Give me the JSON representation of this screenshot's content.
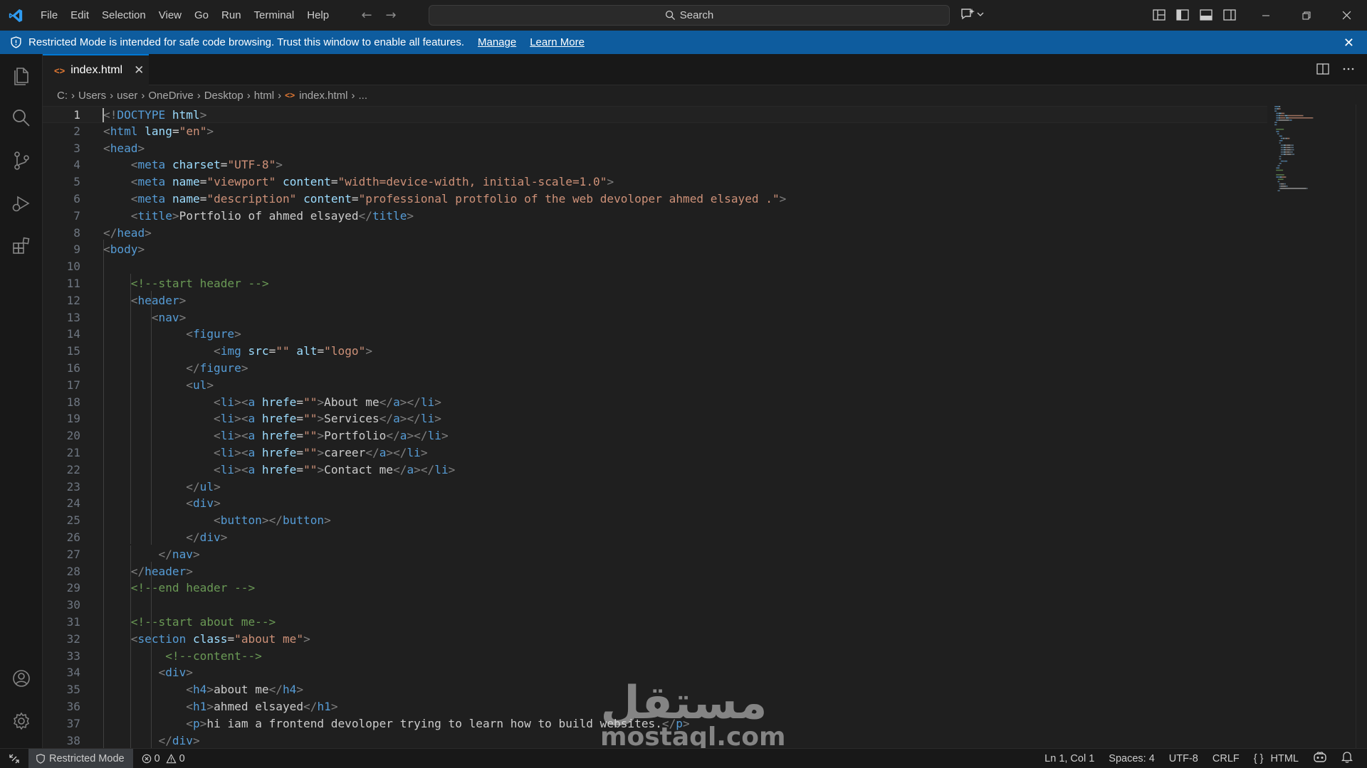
{
  "titlebar": {
    "menu": [
      "File",
      "Edit",
      "Selection",
      "View",
      "Go",
      "Run",
      "Terminal",
      "Help"
    ],
    "search_label": "Search",
    "back_icon": "arrow-left-icon",
    "forward_icon": "arrow-right-icon"
  },
  "banner": {
    "text": "Restricted Mode is intended for safe code browsing. Trust this window to enable all features.",
    "manage_label": "Manage",
    "learn_more_label": "Learn More",
    "color": "#0e5c9e"
  },
  "tabs": [
    {
      "label": "index.html",
      "active": true,
      "icon_text": "<>"
    }
  ],
  "breadcrumb": {
    "items": [
      "C:",
      "Users",
      "user",
      "OneDrive",
      "Desktop",
      "html",
      "index.html",
      "..."
    ],
    "file_icon_text": "<>"
  },
  "editor": {
    "lines": [
      {
        "n": "1",
        "tokens": [
          [
            "t-tag",
            "<!"
          ],
          [
            "t-kw",
            "DOCTYPE"
          ],
          [
            "t-txt",
            " "
          ],
          [
            "t-attr",
            "html"
          ],
          [
            "t-tag",
            ">"
          ]
        ]
      },
      {
        "n": "2",
        "tokens": [
          [
            "t-tag",
            "<"
          ],
          [
            "t-name",
            "html"
          ],
          [
            "t-txt",
            " "
          ],
          [
            "t-attr",
            "lang"
          ],
          [
            "t-txt",
            "="
          ],
          [
            "t-str",
            "\"en\""
          ],
          [
            "t-tag",
            ">"
          ]
        ]
      },
      {
        "n": "3",
        "tokens": [
          [
            "t-tag",
            "<"
          ],
          [
            "t-name",
            "head"
          ],
          [
            "t-tag",
            ">"
          ]
        ]
      },
      {
        "n": "4",
        "tokens": [
          [
            "t-txt",
            "    "
          ],
          [
            "t-tag",
            "<"
          ],
          [
            "t-name",
            "meta"
          ],
          [
            "t-txt",
            " "
          ],
          [
            "t-attr",
            "charset"
          ],
          [
            "t-txt",
            "="
          ],
          [
            "t-str",
            "\"UTF-8\""
          ],
          [
            "t-tag",
            ">"
          ]
        ]
      },
      {
        "n": "5",
        "tokens": [
          [
            "t-txt",
            "    "
          ],
          [
            "t-tag",
            "<"
          ],
          [
            "t-name",
            "meta"
          ],
          [
            "t-txt",
            " "
          ],
          [
            "t-attr",
            "name"
          ],
          [
            "t-txt",
            "="
          ],
          [
            "t-str",
            "\"viewport\""
          ],
          [
            "t-txt",
            " "
          ],
          [
            "t-attr",
            "content"
          ],
          [
            "t-txt",
            "="
          ],
          [
            "t-str",
            "\"width=device-width, initial-scale=1.0\""
          ],
          [
            "t-tag",
            ">"
          ]
        ]
      },
      {
        "n": "6",
        "tokens": [
          [
            "t-txt",
            "    "
          ],
          [
            "t-tag",
            "<"
          ],
          [
            "t-name",
            "meta"
          ],
          [
            "t-txt",
            " "
          ],
          [
            "t-attr",
            "name"
          ],
          [
            "t-txt",
            "="
          ],
          [
            "t-str",
            "\"description\""
          ],
          [
            "t-txt",
            " "
          ],
          [
            "t-attr",
            "content"
          ],
          [
            "t-txt",
            "="
          ],
          [
            "t-str",
            "\"professional protfolio of the web devoloper ahmed elsayed .\""
          ],
          [
            "t-tag",
            ">"
          ]
        ]
      },
      {
        "n": "7",
        "tokens": [
          [
            "t-txt",
            "    "
          ],
          [
            "t-tag",
            "<"
          ],
          [
            "t-name",
            "title"
          ],
          [
            "t-tag",
            ">"
          ],
          [
            "t-txt",
            "Portfolio of ahmed elsayed"
          ],
          [
            "t-tag",
            "</"
          ],
          [
            "t-name",
            "title"
          ],
          [
            "t-tag",
            ">"
          ]
        ]
      },
      {
        "n": "8",
        "tokens": [
          [
            "t-tag",
            "</"
          ],
          [
            "t-name",
            "head"
          ],
          [
            "t-tag",
            ">"
          ]
        ]
      },
      {
        "n": "9",
        "tokens": [
          [
            "t-tag",
            "<"
          ],
          [
            "t-name",
            "body"
          ],
          [
            "t-tag",
            ">"
          ]
        ]
      },
      {
        "n": "10",
        "tokens": []
      },
      {
        "n": "11",
        "tokens": [
          [
            "t-txt",
            "    "
          ],
          [
            "t-cmt",
            "<!--start header -->"
          ]
        ]
      },
      {
        "n": "12",
        "tokens": [
          [
            "t-txt",
            "    "
          ],
          [
            "t-tag",
            "<"
          ],
          [
            "t-name",
            "header"
          ],
          [
            "t-tag",
            ">"
          ]
        ]
      },
      {
        "n": "13",
        "tokens": [
          [
            "t-txt",
            "       "
          ],
          [
            "t-tag",
            "<"
          ],
          [
            "t-name",
            "nav"
          ],
          [
            "t-tag",
            ">"
          ]
        ]
      },
      {
        "n": "14",
        "tokens": [
          [
            "t-txt",
            "            "
          ],
          [
            "t-tag",
            "<"
          ],
          [
            "t-name",
            "figure"
          ],
          [
            "t-tag",
            ">"
          ]
        ]
      },
      {
        "n": "15",
        "tokens": [
          [
            "t-txt",
            "                "
          ],
          [
            "t-tag",
            "<"
          ],
          [
            "t-name",
            "img"
          ],
          [
            "t-txt",
            " "
          ],
          [
            "t-attr",
            "src"
          ],
          [
            "t-txt",
            "="
          ],
          [
            "t-str",
            "\"\""
          ],
          [
            "t-txt",
            " "
          ],
          [
            "t-attr",
            "alt"
          ],
          [
            "t-txt",
            "="
          ],
          [
            "t-str",
            "\"logo\""
          ],
          [
            "t-tag",
            ">"
          ]
        ]
      },
      {
        "n": "16",
        "tokens": [
          [
            "t-txt",
            "            "
          ],
          [
            "t-tag",
            "</"
          ],
          [
            "t-name",
            "figure"
          ],
          [
            "t-tag",
            ">"
          ]
        ]
      },
      {
        "n": "17",
        "tokens": [
          [
            "t-txt",
            "            "
          ],
          [
            "t-tag",
            "<"
          ],
          [
            "t-name",
            "ul"
          ],
          [
            "t-tag",
            ">"
          ]
        ]
      },
      {
        "n": "18",
        "tokens": [
          [
            "t-txt",
            "                "
          ],
          [
            "t-tag",
            "<"
          ],
          [
            "t-name",
            "li"
          ],
          [
            "t-tag",
            "><"
          ],
          [
            "t-name",
            "a"
          ],
          [
            "t-txt",
            " "
          ],
          [
            "t-attr",
            "hrefe"
          ],
          [
            "t-txt",
            "="
          ],
          [
            "t-str",
            "\"\""
          ],
          [
            "t-tag",
            ">"
          ],
          [
            "t-txt",
            "About me"
          ],
          [
            "t-tag",
            "</"
          ],
          [
            "t-name",
            "a"
          ],
          [
            "t-tag",
            "></"
          ],
          [
            "t-name",
            "li"
          ],
          [
            "t-tag",
            ">"
          ]
        ]
      },
      {
        "n": "19",
        "tokens": [
          [
            "t-txt",
            "                "
          ],
          [
            "t-tag",
            "<"
          ],
          [
            "t-name",
            "li"
          ],
          [
            "t-tag",
            "><"
          ],
          [
            "t-name",
            "a"
          ],
          [
            "t-txt",
            " "
          ],
          [
            "t-attr",
            "hrefe"
          ],
          [
            "t-txt",
            "="
          ],
          [
            "t-str",
            "\"\""
          ],
          [
            "t-tag",
            ">"
          ],
          [
            "t-txt",
            "Services"
          ],
          [
            "t-tag",
            "</"
          ],
          [
            "t-name",
            "a"
          ],
          [
            "t-tag",
            "></"
          ],
          [
            "t-name",
            "li"
          ],
          [
            "t-tag",
            ">"
          ]
        ]
      },
      {
        "n": "20",
        "tokens": [
          [
            "t-txt",
            "                "
          ],
          [
            "t-tag",
            "<"
          ],
          [
            "t-name",
            "li"
          ],
          [
            "t-tag",
            "><"
          ],
          [
            "t-name",
            "a"
          ],
          [
            "t-txt",
            " "
          ],
          [
            "t-attr",
            "hrefe"
          ],
          [
            "t-txt",
            "="
          ],
          [
            "t-str",
            "\"\""
          ],
          [
            "t-tag",
            ">"
          ],
          [
            "t-txt",
            "Portfolio"
          ],
          [
            "t-tag",
            "</"
          ],
          [
            "t-name",
            "a"
          ],
          [
            "t-tag",
            "></"
          ],
          [
            "t-name",
            "li"
          ],
          [
            "t-tag",
            ">"
          ]
        ]
      },
      {
        "n": "21",
        "tokens": [
          [
            "t-txt",
            "                "
          ],
          [
            "t-tag",
            "<"
          ],
          [
            "t-name",
            "li"
          ],
          [
            "t-tag",
            "><"
          ],
          [
            "t-name",
            "a"
          ],
          [
            "t-txt",
            " "
          ],
          [
            "t-attr",
            "hrefe"
          ],
          [
            "t-txt",
            "="
          ],
          [
            "t-str",
            "\"\""
          ],
          [
            "t-tag",
            ">"
          ],
          [
            "t-txt",
            "career"
          ],
          [
            "t-tag",
            "</"
          ],
          [
            "t-name",
            "a"
          ],
          [
            "t-tag",
            "></"
          ],
          [
            "t-name",
            "li"
          ],
          [
            "t-tag",
            ">"
          ]
        ]
      },
      {
        "n": "22",
        "tokens": [
          [
            "t-txt",
            "                "
          ],
          [
            "t-tag",
            "<"
          ],
          [
            "t-name",
            "li"
          ],
          [
            "t-tag",
            "><"
          ],
          [
            "t-name",
            "a"
          ],
          [
            "t-txt",
            " "
          ],
          [
            "t-attr",
            "hrefe"
          ],
          [
            "t-txt",
            "="
          ],
          [
            "t-str",
            "\"\""
          ],
          [
            "t-tag",
            ">"
          ],
          [
            "t-txt",
            "Contact me"
          ],
          [
            "t-tag",
            "</"
          ],
          [
            "t-name",
            "a"
          ],
          [
            "t-tag",
            "></"
          ],
          [
            "t-name",
            "li"
          ],
          [
            "t-tag",
            ">"
          ]
        ]
      },
      {
        "n": "23",
        "tokens": [
          [
            "t-txt",
            "            "
          ],
          [
            "t-tag",
            "</"
          ],
          [
            "t-name",
            "ul"
          ],
          [
            "t-tag",
            ">"
          ]
        ]
      },
      {
        "n": "24",
        "tokens": [
          [
            "t-txt",
            "            "
          ],
          [
            "t-tag",
            "<"
          ],
          [
            "t-name",
            "div"
          ],
          [
            "t-tag",
            ">"
          ]
        ]
      },
      {
        "n": "25",
        "tokens": [
          [
            "t-txt",
            "                "
          ],
          [
            "t-tag",
            "<"
          ],
          [
            "t-name",
            "button"
          ],
          [
            "t-tag",
            "></"
          ],
          [
            "t-name",
            "button"
          ],
          [
            "t-tag",
            ">"
          ]
        ]
      },
      {
        "n": "26",
        "tokens": [
          [
            "t-txt",
            "            "
          ],
          [
            "t-tag",
            "</"
          ],
          [
            "t-name",
            "div"
          ],
          [
            "t-tag",
            ">"
          ]
        ]
      },
      {
        "n": "27",
        "tokens": [
          [
            "t-txt",
            "        "
          ],
          [
            "t-tag",
            "</"
          ],
          [
            "t-name",
            "nav"
          ],
          [
            "t-tag",
            ">"
          ]
        ]
      },
      {
        "n": "28",
        "tokens": [
          [
            "t-txt",
            "    "
          ],
          [
            "t-tag",
            "</"
          ],
          [
            "t-name",
            "header"
          ],
          [
            "t-tag",
            ">"
          ]
        ]
      },
      {
        "n": "29",
        "tokens": [
          [
            "t-txt",
            "    "
          ],
          [
            "t-cmt",
            "<!--end header -->"
          ]
        ]
      },
      {
        "n": "30",
        "tokens": []
      },
      {
        "n": "31",
        "tokens": [
          [
            "t-txt",
            "    "
          ],
          [
            "t-cmt",
            "<!--start about me-->"
          ]
        ]
      },
      {
        "n": "32",
        "tokens": [
          [
            "t-txt",
            "    "
          ],
          [
            "t-tag",
            "<"
          ],
          [
            "t-name",
            "section"
          ],
          [
            "t-txt",
            " "
          ],
          [
            "t-attr",
            "class"
          ],
          [
            "t-txt",
            "="
          ],
          [
            "t-str",
            "\"about me\""
          ],
          [
            "t-tag",
            ">"
          ]
        ]
      },
      {
        "n": "33",
        "tokens": [
          [
            "t-txt",
            "         "
          ],
          [
            "t-cmt",
            "<!--content-->"
          ]
        ]
      },
      {
        "n": "34",
        "tokens": [
          [
            "t-txt",
            "        "
          ],
          [
            "t-tag",
            "<"
          ],
          [
            "t-name",
            "div"
          ],
          [
            "t-tag",
            ">"
          ]
        ]
      },
      {
        "n": "35",
        "tokens": [
          [
            "t-txt",
            "            "
          ],
          [
            "t-tag",
            "<"
          ],
          [
            "t-name",
            "h4"
          ],
          [
            "t-tag",
            ">"
          ],
          [
            "t-txt",
            "about me"
          ],
          [
            "t-tag",
            "</"
          ],
          [
            "t-name",
            "h4"
          ],
          [
            "t-tag",
            ">"
          ]
        ]
      },
      {
        "n": "36",
        "tokens": [
          [
            "t-txt",
            "            "
          ],
          [
            "t-tag",
            "<"
          ],
          [
            "t-name",
            "h1"
          ],
          [
            "t-tag",
            ">"
          ],
          [
            "t-txt",
            "ahmed elsayed"
          ],
          [
            "t-tag",
            "</"
          ],
          [
            "t-name",
            "h1"
          ],
          [
            "t-tag",
            ">"
          ]
        ]
      },
      {
        "n": "37",
        "tokens": [
          [
            "t-txt",
            "            "
          ],
          [
            "t-tag",
            "<"
          ],
          [
            "t-name",
            "p"
          ],
          [
            "t-tag",
            ">"
          ],
          [
            "t-txt",
            "hi iam a frontend devoloper trying to learn how to build websites."
          ],
          [
            "t-tag",
            "</"
          ],
          [
            "t-name",
            "p"
          ],
          [
            "t-tag",
            ">"
          ]
        ]
      },
      {
        "n": "38",
        "tokens": [
          [
            "t-txt",
            "        "
          ],
          [
            "t-tag",
            "</"
          ],
          [
            "t-name",
            "div"
          ],
          [
            "t-tag",
            ">"
          ]
        ]
      }
    ]
  },
  "watermark": {
    "arabic": "مستقل",
    "latin": "mostaql.com"
  },
  "statusbar": {
    "restricted_label": "Restricted Mode",
    "errors": "0",
    "warnings": "0",
    "position": "Ln 1, Col 1",
    "spaces": "Spaces: 4",
    "encoding": "UTF-8",
    "eol": "CRLF",
    "language": "HTML",
    "language_icon": "{ }"
  }
}
